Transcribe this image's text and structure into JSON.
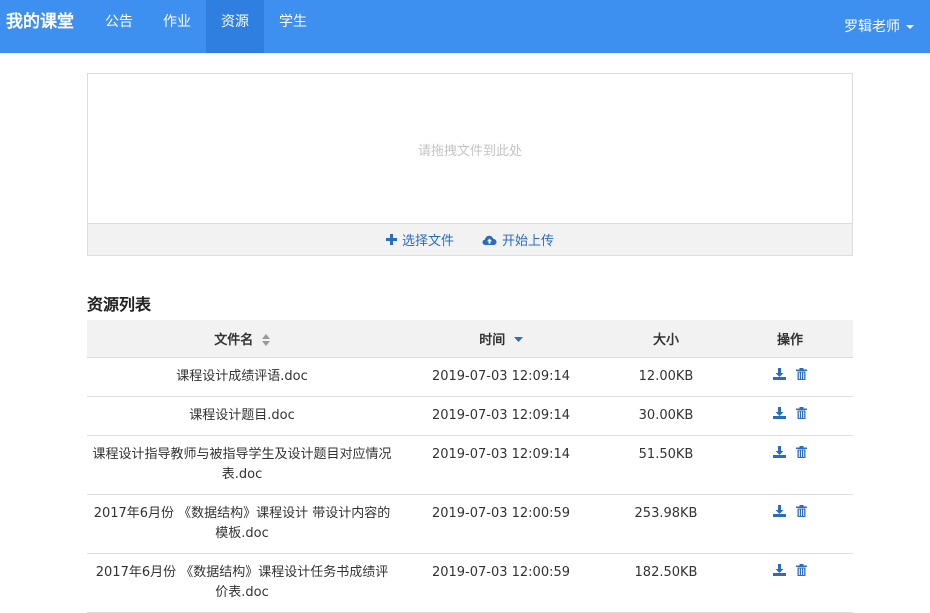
{
  "navbar": {
    "brand": "我的课堂",
    "items": [
      {
        "label": "公告"
      },
      {
        "label": "作业"
      },
      {
        "label": "资源"
      },
      {
        "label": "学生"
      }
    ],
    "active_item": "资源",
    "user": "罗辑老师"
  },
  "upload": {
    "hint": "请拖拽文件到此处",
    "choose_label": "选择文件",
    "start_label": "开始上传"
  },
  "resources": {
    "title": "资源列表",
    "columns": {
      "name": "文件名",
      "time": "时间",
      "size": "大小",
      "ops": "操作"
    },
    "rows": [
      {
        "name": "课程设计成绩评语.doc",
        "time": "2019-07-03 12:09:14",
        "size": "12.00KB"
      },
      {
        "name": "课程设计题目.doc",
        "time": "2019-07-03 12:09:14",
        "size": "30.00KB"
      },
      {
        "name": "课程设计指导教师与被指导学生及设计题目对应情况表.doc",
        "time": "2019-07-03 12:09:14",
        "size": "51.50KB"
      },
      {
        "name": "2017年6月份 《数据结构》课程设计 带设计内容的模板.doc",
        "time": "2019-07-03 12:00:59",
        "size": "253.98KB"
      },
      {
        "name": "2017年6月份 《数据结构》课程设计任务书成绩评价表.doc",
        "time": "2019-07-03 12:00:59",
        "size": "182.50KB"
      }
    ]
  },
  "colors": {
    "navbar": "#3d8ff0",
    "navbar_active": "#2f7fe0",
    "link": "#2a6cc0"
  }
}
